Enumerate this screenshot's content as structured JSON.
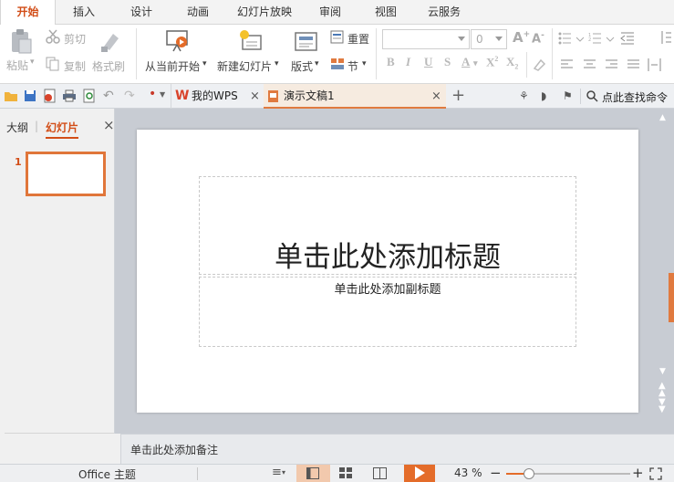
{
  "menu": {
    "tabs": [
      {
        "label": "开始",
        "active": true
      },
      {
        "label": "插入"
      },
      {
        "label": "设计"
      },
      {
        "label": "动画"
      },
      {
        "label": "幻灯片放映"
      },
      {
        "label": "审阅"
      },
      {
        "label": "视图"
      },
      {
        "label": "云服务"
      }
    ]
  },
  "ribbon": {
    "paste": "粘贴",
    "cut": "剪切",
    "copy": "复制",
    "format_painter": "格式刷",
    "from_current": "从当前开始",
    "new_slide": "新建幻灯片",
    "layout": "版式",
    "reset": "重置",
    "section": "节",
    "font_size_value": "0"
  },
  "qat": {
    "doc_tabs": [
      {
        "label": "我的WPS"
      },
      {
        "label": "演示文稿1",
        "active": true
      }
    ],
    "search_label": "点此查找命令"
  },
  "left_panel": {
    "tab_outline": "大纲",
    "tab_slides": "幻灯片",
    "slide_number": "1"
  },
  "slide": {
    "title_placeholder": "单击此处添加标题",
    "subtitle_placeholder": "单击此处添加副标题"
  },
  "notes": {
    "placeholder": "单击此处添加备注"
  },
  "status": {
    "theme": "Office 主题",
    "zoom": "43 %"
  },
  "colors": {
    "accent": "#d24d17",
    "thumb_border": "#e0763a",
    "play_button": "#e46c2a"
  }
}
